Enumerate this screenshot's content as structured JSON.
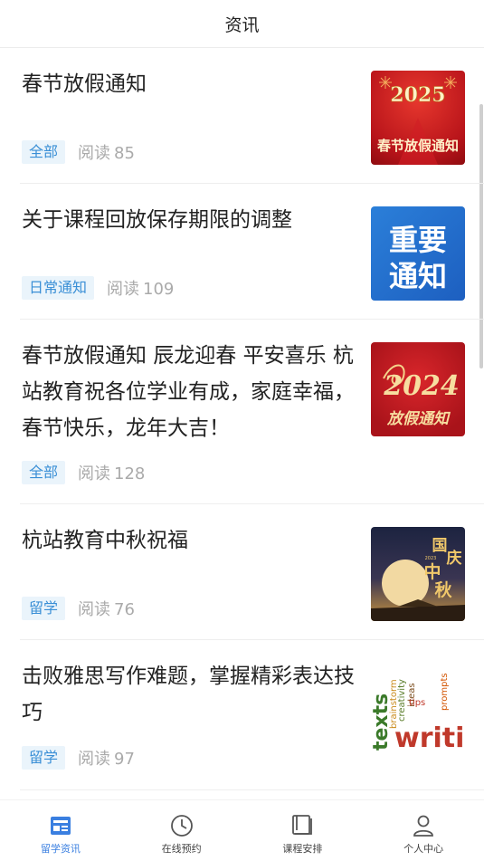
{
  "header": {
    "title": "资讯"
  },
  "articles": [
    {
      "title": "春节放假通知",
      "tag": "全部",
      "reads_label": "阅读",
      "reads": "85",
      "thumb_text": [
        "2025",
        "春节放假通知"
      ]
    },
    {
      "title": "关于课程回放保存期限的调整",
      "tag": "日常通知",
      "reads_label": "阅读",
      "reads": "109",
      "thumb_text": [
        "重要",
        "通知"
      ]
    },
    {
      "title": "春节放假通知 辰龙迎春 平安喜乐 杭站教育祝各位学业有成，家庭幸福，春节快乐，龙年大吉！",
      "tag": "全部",
      "reads_label": "阅读",
      "reads": "128",
      "thumb_text": [
        "2024",
        "放假通知"
      ]
    },
    {
      "title": "杭站教育中秋祝福",
      "tag": "留学",
      "reads_label": "阅读",
      "reads": "76",
      "thumb_text": [
        "国",
        "庆",
        "中",
        "秋",
        "2023"
      ]
    },
    {
      "title": "击败雅思写作难题，掌握精彩表达技巧",
      "tag": "留学",
      "reads_label": "阅读",
      "reads": "97",
      "thumb_text": [
        "texts",
        "brainstorm",
        "creativity",
        "ideas",
        "tips",
        "prompts",
        "writi"
      ]
    }
  ],
  "tabbar": {
    "items": [
      {
        "label": "留学资讯",
        "icon": "news-icon",
        "active": true
      },
      {
        "label": "在线预约",
        "icon": "clock-icon",
        "active": false
      },
      {
        "label": "课程安排",
        "icon": "book-icon",
        "active": false
      },
      {
        "label": "个人中心",
        "icon": "person-icon",
        "active": false
      }
    ]
  },
  "colors": {
    "accent": "#3a7fe0",
    "tag_text": "#3a8fd6",
    "tag_bg": "#eaf4fb",
    "muted": "#aaaaaa"
  }
}
